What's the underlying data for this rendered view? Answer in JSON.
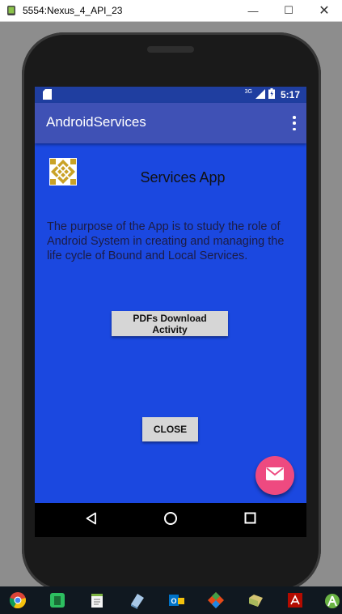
{
  "window": {
    "title": "5554:Nexus_4_API_23",
    "minimize_glyph": "—",
    "maximize_glyph": "☐",
    "close_glyph": "✕"
  },
  "statusbar": {
    "network": "3G",
    "time": "5:17"
  },
  "actionbar": {
    "title": "AndroidServices"
  },
  "content": {
    "heading": "Services App",
    "description": "The purpose of the App is to study the role of Android System in creating and managing the life cycle of Bound and Local Services.",
    "pdf_button_label": "PDFs Download Activity",
    "close_button_label": "CLOSE"
  },
  "colors": {
    "screen_bg": "#1b48e0",
    "actionbar": "#3f51b5",
    "statusbar": "#1f3ea0",
    "fab": "#ee4a80",
    "logo_gold": "#c9a227"
  },
  "icons": {
    "statusbar_left": "sd-card-icon",
    "fab": "mail-icon",
    "nav": [
      "back-icon",
      "home-icon",
      "recents-icon"
    ],
    "taskbar": [
      "chrome-icon",
      "evernote-icon",
      "notepad-icon",
      "notebook-icon",
      "outlook-icon",
      "git-icon",
      "folder-icon",
      "acrobat-icon",
      "android-icon"
    ]
  }
}
